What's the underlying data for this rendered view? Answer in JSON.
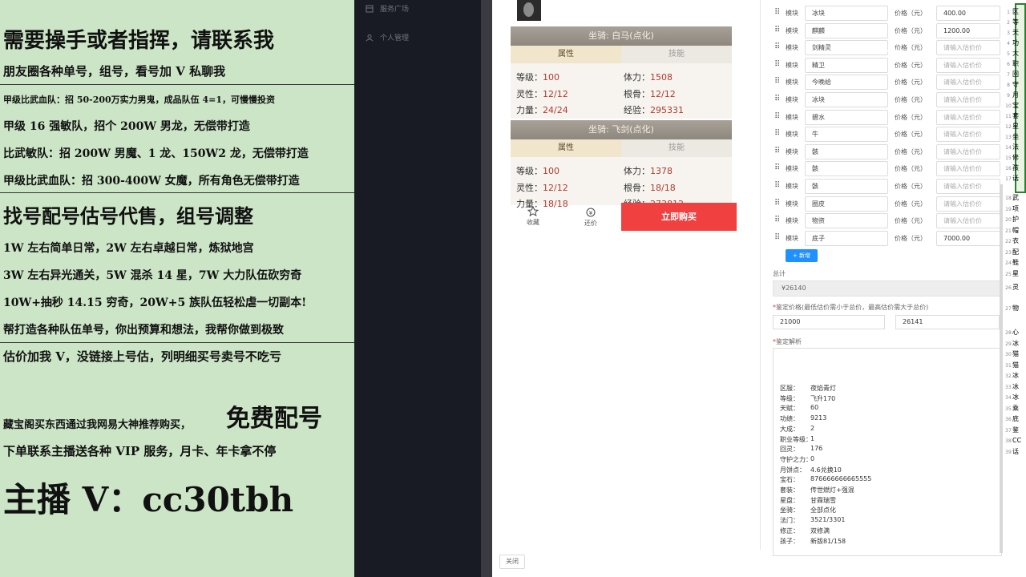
{
  "overlay": {
    "lines": [
      "需要操手或者指挥，请联系我",
      "朋友圈各种单号，组号，看号加 V 私聊我",
      "甲级比武血队：招 50-200万实力男鬼，成品队伍 4=1，可慢慢投资",
      "甲级 16 强敏队，招个 200W 男龙，无偿带打造",
      "比武敏队：招 200W 男魔、1 龙、150W2 龙，无偿带打造",
      "甲级比武血队：招 300-400W 女魔，所有角色无偿带打造",
      "找号配号估号代售，组号调整",
      "1W 左右简单日常，2W 左右卓越日常，炼狱地宫",
      "3W 左右异光通关，5W 混杀 14 星，7W 大力队伍砍穷奇",
      "10W+抽秒 14.15 穷奇，20W+5 族队伍轻松虐一切副本!",
      "帮打造各种队伍单号，你出预算和想法，我帮你做到极致",
      "估价加我 V，没链接上号估，列明细买号卖号不吃亏",
      "藏宝阁买东西通过我网易大神推荐购买，",
      "免费配号",
      "下单联系主播送各种 VIP 服务，月卡、年卡拿不停",
      "主播 V：cc30tbh"
    ]
  },
  "sidebar": {
    "items": [
      "服务广场",
      "个人管理"
    ]
  },
  "phone": {
    "mount1": "坐骑: 白马(点化)",
    "mount2": "坐骑: 飞剑(点化)",
    "tab_attr": "属性",
    "tab_skill": "技能",
    "stats1": {
      "level_k": "等级：",
      "level_v": "100",
      "stamina_k": "体力：",
      "stamina_v": "1508",
      "spirit_k": "灵性：",
      "spirit_v": "12/12",
      "root_k": "根骨：",
      "root_v": "12/12",
      "power_k": "力量：",
      "power_v": "24/24",
      "exp_k": "经验：",
      "exp_v": "295331"
    },
    "stats2": {
      "level_k": "等级：",
      "level_v": "100",
      "stamina_k": "体力：",
      "stamina_v": "1378",
      "spirit_k": "灵性：",
      "spirit_v": "12/12",
      "root_k": "根骨：",
      "root_v": "18/18",
      "power_k": "力量：",
      "power_v": "18/18",
      "exp_k": "经验：",
      "exp_v": "273812"
    },
    "fav": "收藏",
    "bargain": "还价",
    "buy": "立即购买"
  },
  "form": {
    "module_label": "模块",
    "price_label": "价格（元）",
    "price_placeholder": "请输入估价价",
    "rows": [
      {
        "name": "冰块",
        "price": "400.00"
      },
      {
        "name": "麒麟",
        "price": "1200.00"
      },
      {
        "name": "剑精灵",
        "price": ""
      },
      {
        "name": "精卫",
        "price": ""
      },
      {
        "name": "今晚给",
        "price": ""
      },
      {
        "name": "冰块",
        "price": ""
      },
      {
        "name": "碧水",
        "price": ""
      },
      {
        "name": "牛",
        "price": ""
      },
      {
        "name": "骸",
        "price": ""
      },
      {
        "name": "骸",
        "price": ""
      },
      {
        "name": "骸",
        "price": ""
      },
      {
        "name": "圈皮",
        "price": ""
      },
      {
        "name": "物资",
        "price": ""
      },
      {
        "name": "底子",
        "price": "7000.00"
      }
    ],
    "add": "新增",
    "total_label": "总计",
    "total": "¥26140",
    "range_label": "鉴定价格(最低估价需小于总价，最高估价需大于总价)",
    "min": "21000",
    "max": "26141",
    "analysis_label": "鉴定解析",
    "analysis": [
      {
        "k": "区服：",
        "v": "夜焰青灯"
      },
      {
        "k": "等级：",
        "v": "飞升170"
      },
      {
        "k": "天赋：",
        "v": "60"
      },
      {
        "k": "功绩：",
        "v": "9213"
      },
      {
        "k": "大成：",
        "v": "2"
      },
      {
        "k": "职业等级：",
        "v": "1"
      },
      {
        "k": "回灵：",
        "v": "176"
      },
      {
        "k": "守护之力：",
        "v": "0"
      },
      {
        "k": "月饼点：",
        "v": "4.6兑换10"
      },
      {
        "k": "宝石：",
        "v": "876666666665555"
      },
      {
        "k": "套装：",
        "v": "传世燃灯+强混"
      },
      {
        "k": "星盘：",
        "v": "甘霖瑞雪"
      },
      {
        "k": "坐骑：",
        "v": "全部点化"
      },
      {
        "k": "法门：",
        "v": "3521/3301"
      },
      {
        "k": "修正：",
        "v": "双修满"
      },
      {
        "k": "孩子：",
        "v": "新版81/158"
      }
    ],
    "close": "关闭"
  },
  "right_strip": {
    "cells": [
      "区",
      "等",
      "天",
      "功",
      "大",
      "职",
      "回",
      "守",
      "月",
      "宝",
      "套",
      "星",
      "坐",
      "法",
      "修",
      "孩",
      "话",
      "武",
      "项",
      "护",
      "帽",
      "衣",
      "配",
      "鞋",
      "星",
      "灵",
      "物",
      "心",
      "冰",
      "猫",
      "猫",
      "冰",
      "冰",
      "冰",
      "乘",
      "底",
      "鉴",
      "CC",
      "话"
    ]
  }
}
